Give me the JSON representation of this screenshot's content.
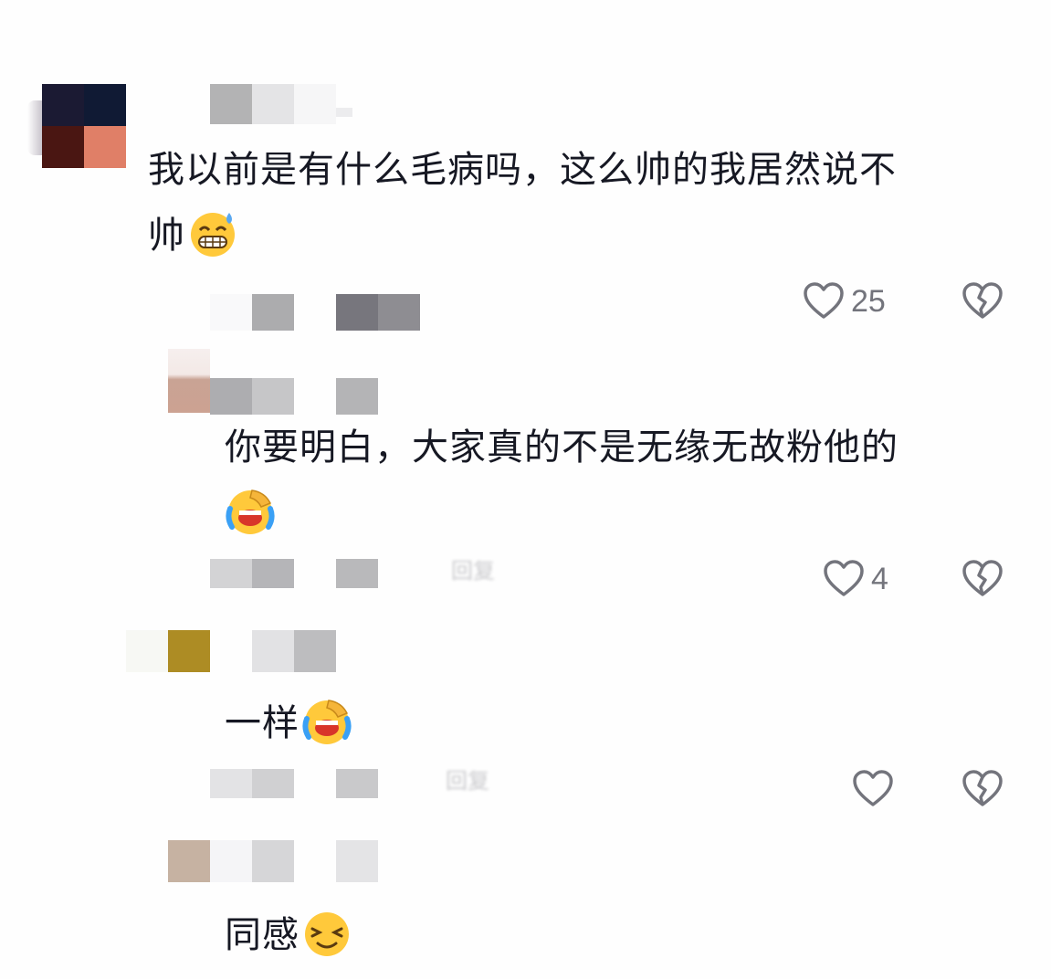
{
  "comments": [
    {
      "text": "我以前是有什么毛病吗，这么帅的我居然说不",
      "text_line2": "帅",
      "emoji": "grinning-sweat-emoji",
      "likes": "25"
    },
    {
      "text": "你要明白，大家真的不是无缘无故粉他的",
      "emoji": "crying-laughing-emoji",
      "likes": "4",
      "reply_label": "回复"
    },
    {
      "text": "一样",
      "emoji": "crying-laughing-emoji",
      "likes": "",
      "reply_label": "回复"
    },
    {
      "text": "同感",
      "emoji": "squinting-smile-emoji"
    }
  ],
  "icons": {
    "like": "heart-outline-icon",
    "dislike": "broken-heart-icon"
  },
  "colors": {
    "text": "#161823",
    "secondary": "#73747c",
    "background": "#fefefe"
  }
}
